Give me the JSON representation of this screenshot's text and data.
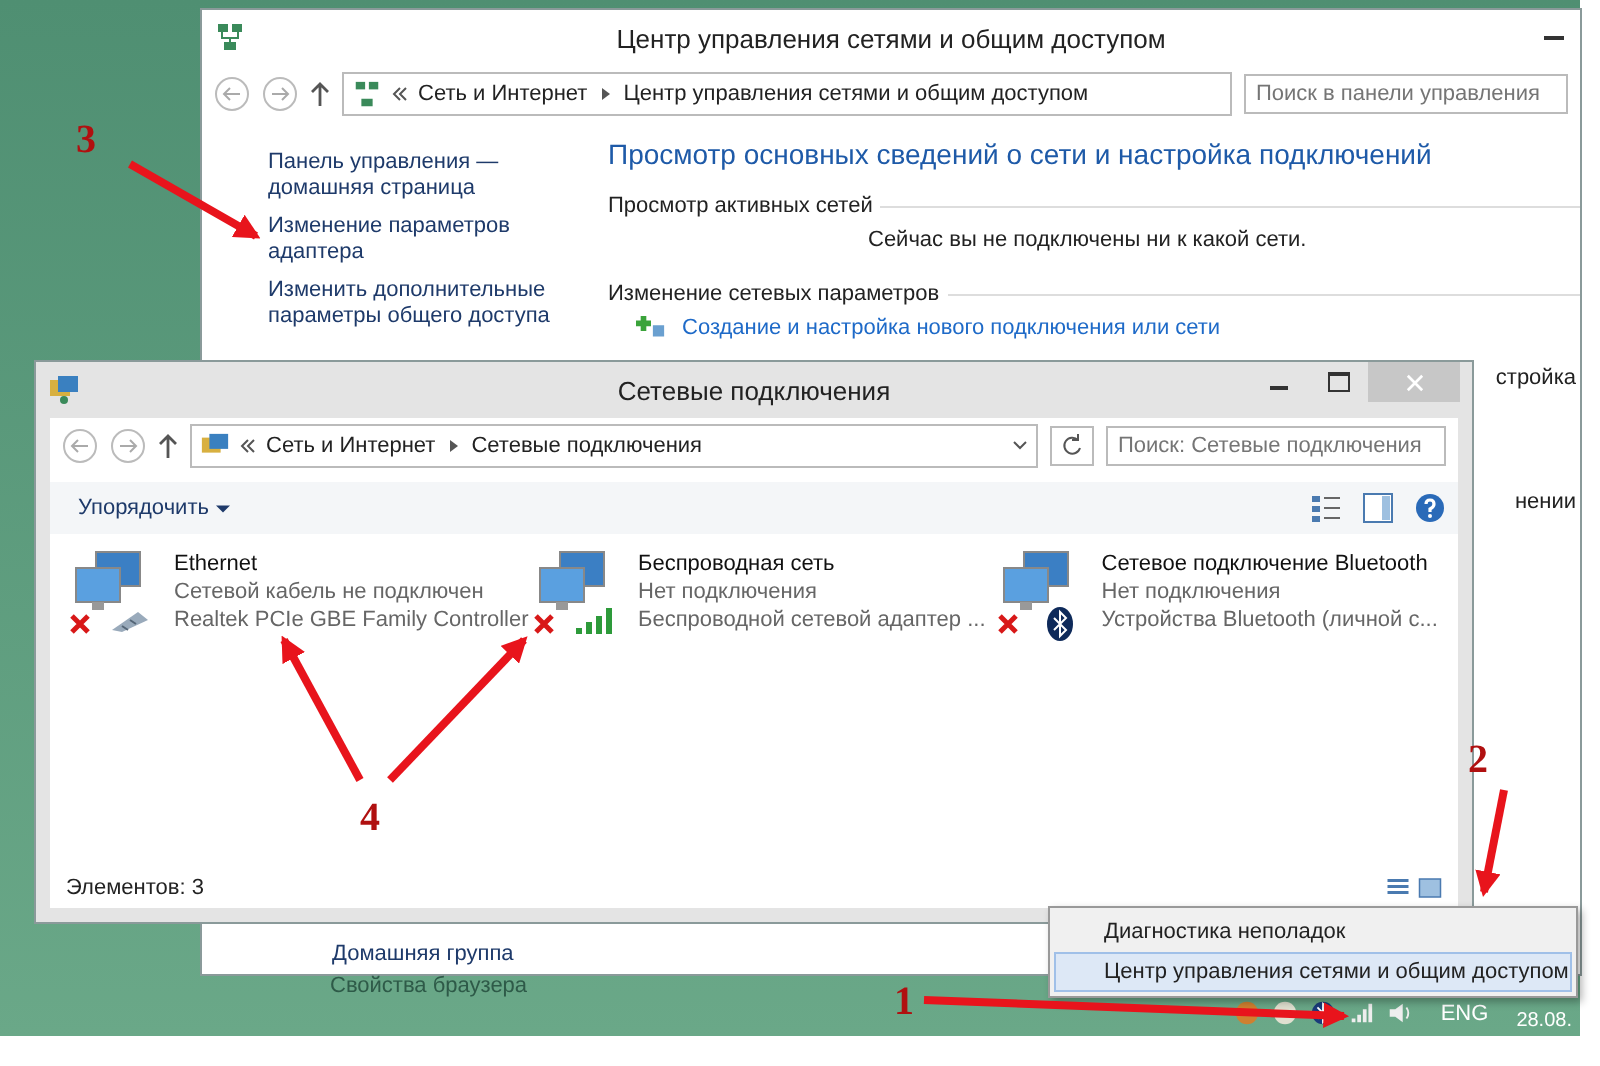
{
  "back_window": {
    "title": "Центр управления сетями и общим доступом",
    "breadcrumb": [
      "Сеть и Интернет",
      "Центр управления сетями и общим доступом"
    ],
    "search": {
      "placeholder": "Поиск в панели управления"
    },
    "sidebar_links": [
      "Панель управления — домашняя страница",
      "Изменение параметров адаптера",
      "Изменить дополнительные параметры общего доступа"
    ],
    "sidebar_bottom": [
      "Домашняя группа",
      "Свойства браузера"
    ],
    "heading": "Просмотр основных сведений о сети и настройка подключений",
    "active_networks": {
      "title": "Просмотр активных сетей",
      "status": "Сейчас вы не подключены ни к какой сети."
    },
    "change_settings": {
      "title": "Изменение сетевых параметров",
      "link": "Создание и настройка нового подключения или сети"
    },
    "partial_texts": [
      "стройка",
      "нении"
    ]
  },
  "front_window": {
    "title": "Сетевые подключения",
    "breadcrumb": [
      "Сеть и Интернет",
      "Сетевые подключения"
    ],
    "search": {
      "placeholder": "Поиск: Сетевые подключения"
    },
    "organize_button": "Упорядочить",
    "connections": [
      {
        "kind": "ethernet",
        "name": "Ethernet",
        "status": "Сетевой кабель не подключен",
        "adapter": "Realtek PCIe GBE Family Controller",
        "connected": false
      },
      {
        "kind": "wireless",
        "name": "Беспроводная сеть",
        "status": "Нет подключения",
        "adapter": "Беспроводной сетевой адаптер ...",
        "connected": false
      },
      {
        "kind": "bluetooth",
        "name": "Сетевое подключение Bluetooth",
        "status": "Нет подключения",
        "adapter": "Устройства Bluetooth (личной с...",
        "connected": false
      }
    ],
    "status_bar": "Элементов: 3"
  },
  "context_menu": {
    "items": [
      {
        "label": "Диагностика неполадок",
        "selected": false
      },
      {
        "label": "Центр управления сетями и общим доступом",
        "selected": true
      }
    ]
  },
  "taskbar": {
    "language": "ENG",
    "date": "28.08."
  },
  "annotations": [
    {
      "label": "1"
    },
    {
      "label": "2"
    },
    {
      "label": "3"
    },
    {
      "label": "4"
    }
  ]
}
